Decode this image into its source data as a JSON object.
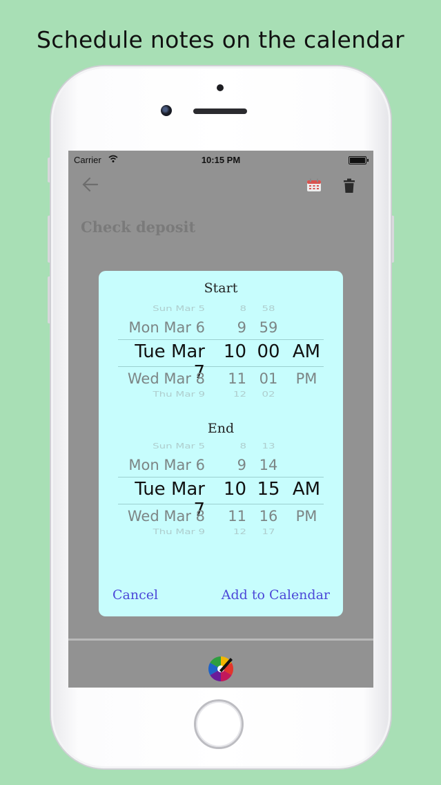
{
  "headline": "Schedule notes on the calendar",
  "status_bar": {
    "carrier": "Carrier",
    "time": "10:15 PM"
  },
  "toolbar": {
    "back_icon": "back-arrow-icon",
    "calendar_icon": "calendar-icon",
    "delete_icon": "trash-icon"
  },
  "note": {
    "title": "Check deposit"
  },
  "dialog": {
    "start_label": "Start",
    "end_label": "End",
    "start_picker": {
      "rows": [
        {
          "date": "Sun Mar 5",
          "hour": "8",
          "minute": "58",
          "ampm": ""
        },
        {
          "date": "Mon Mar 6",
          "hour": "9",
          "minute": "59",
          "ampm": ""
        },
        {
          "date": "Tue Mar 7",
          "hour": "10",
          "minute": "00",
          "ampm": "AM"
        },
        {
          "date": "Wed Mar 8",
          "hour": "11",
          "minute": "01",
          "ampm": "PM"
        },
        {
          "date": "Thu Mar 9",
          "hour": "12",
          "minute": "02",
          "ampm": ""
        }
      ]
    },
    "end_picker": {
      "rows": [
        {
          "date": "Sun Mar 5",
          "hour": "8",
          "minute": "13",
          "ampm": ""
        },
        {
          "date": "Mon Mar 6",
          "hour": "9",
          "minute": "14",
          "ampm": ""
        },
        {
          "date": "Tue Mar 7",
          "hour": "10",
          "minute": "15",
          "ampm": "AM"
        },
        {
          "date": "Wed Mar 8",
          "hour": "11",
          "minute": "16",
          "ampm": "PM"
        },
        {
          "date": "Thu Mar 9",
          "hour": "12",
          "minute": "17",
          "ampm": ""
        }
      ]
    },
    "cancel_label": "Cancel",
    "add_label": "Add to Calendar"
  },
  "colors": {
    "background": "#a8dfb5",
    "dialog": "#c7fdfd",
    "dialog_button": "#4b47d8",
    "overlay": "#929292"
  }
}
